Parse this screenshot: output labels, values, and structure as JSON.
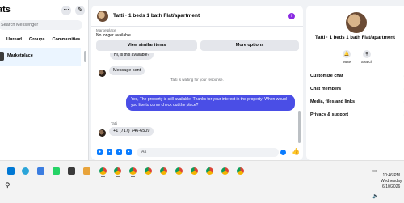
{
  "sidebar": {
    "title": "ats",
    "search_placeholder": "Search Messenger",
    "tabs": [
      "Unread",
      "Groups",
      "Communities"
    ],
    "active_chat": "Marketplace"
  },
  "conversation": {
    "title": "Tatti · 1 beds 1 bath Flat/apartment",
    "marketplace_label": "Marketplace",
    "listing_status": "No longer available",
    "buttons": {
      "view_similar": "View similar items",
      "more_options": "More options"
    },
    "messages": {
      "incoming_top": "Hi, is this available?",
      "incoming_sent": "Message sent",
      "waiting": "Tatti is waiting for your response.",
      "outgoing": "Yes, The property is still available. Thanks for your interest in the property! When would you like to come check out the place?",
      "sender_name": "Tatti",
      "incoming_phone": "+1 (717) 746-6509"
    },
    "composer_placeholder": "Aa"
  },
  "panel": {
    "title": "Tatti · 1 beds 1 bath Flat/apartment",
    "actions": [
      {
        "label": "Mute",
        "icon": "bell-icon"
      },
      {
        "label": "Search",
        "icon": "search-icon"
      }
    ],
    "sections": [
      "Customize chat",
      "Chat members",
      "Media, files and links",
      "Privacy & support"
    ]
  },
  "taskbar": {
    "time": "10:46 PM",
    "day": "Wednesday",
    "date": "6/10/2026"
  },
  "colors": {
    "accent": "#0a7cff",
    "outgoing_bubble": "#4a4ee6",
    "info_badge": "#8a2be2"
  }
}
